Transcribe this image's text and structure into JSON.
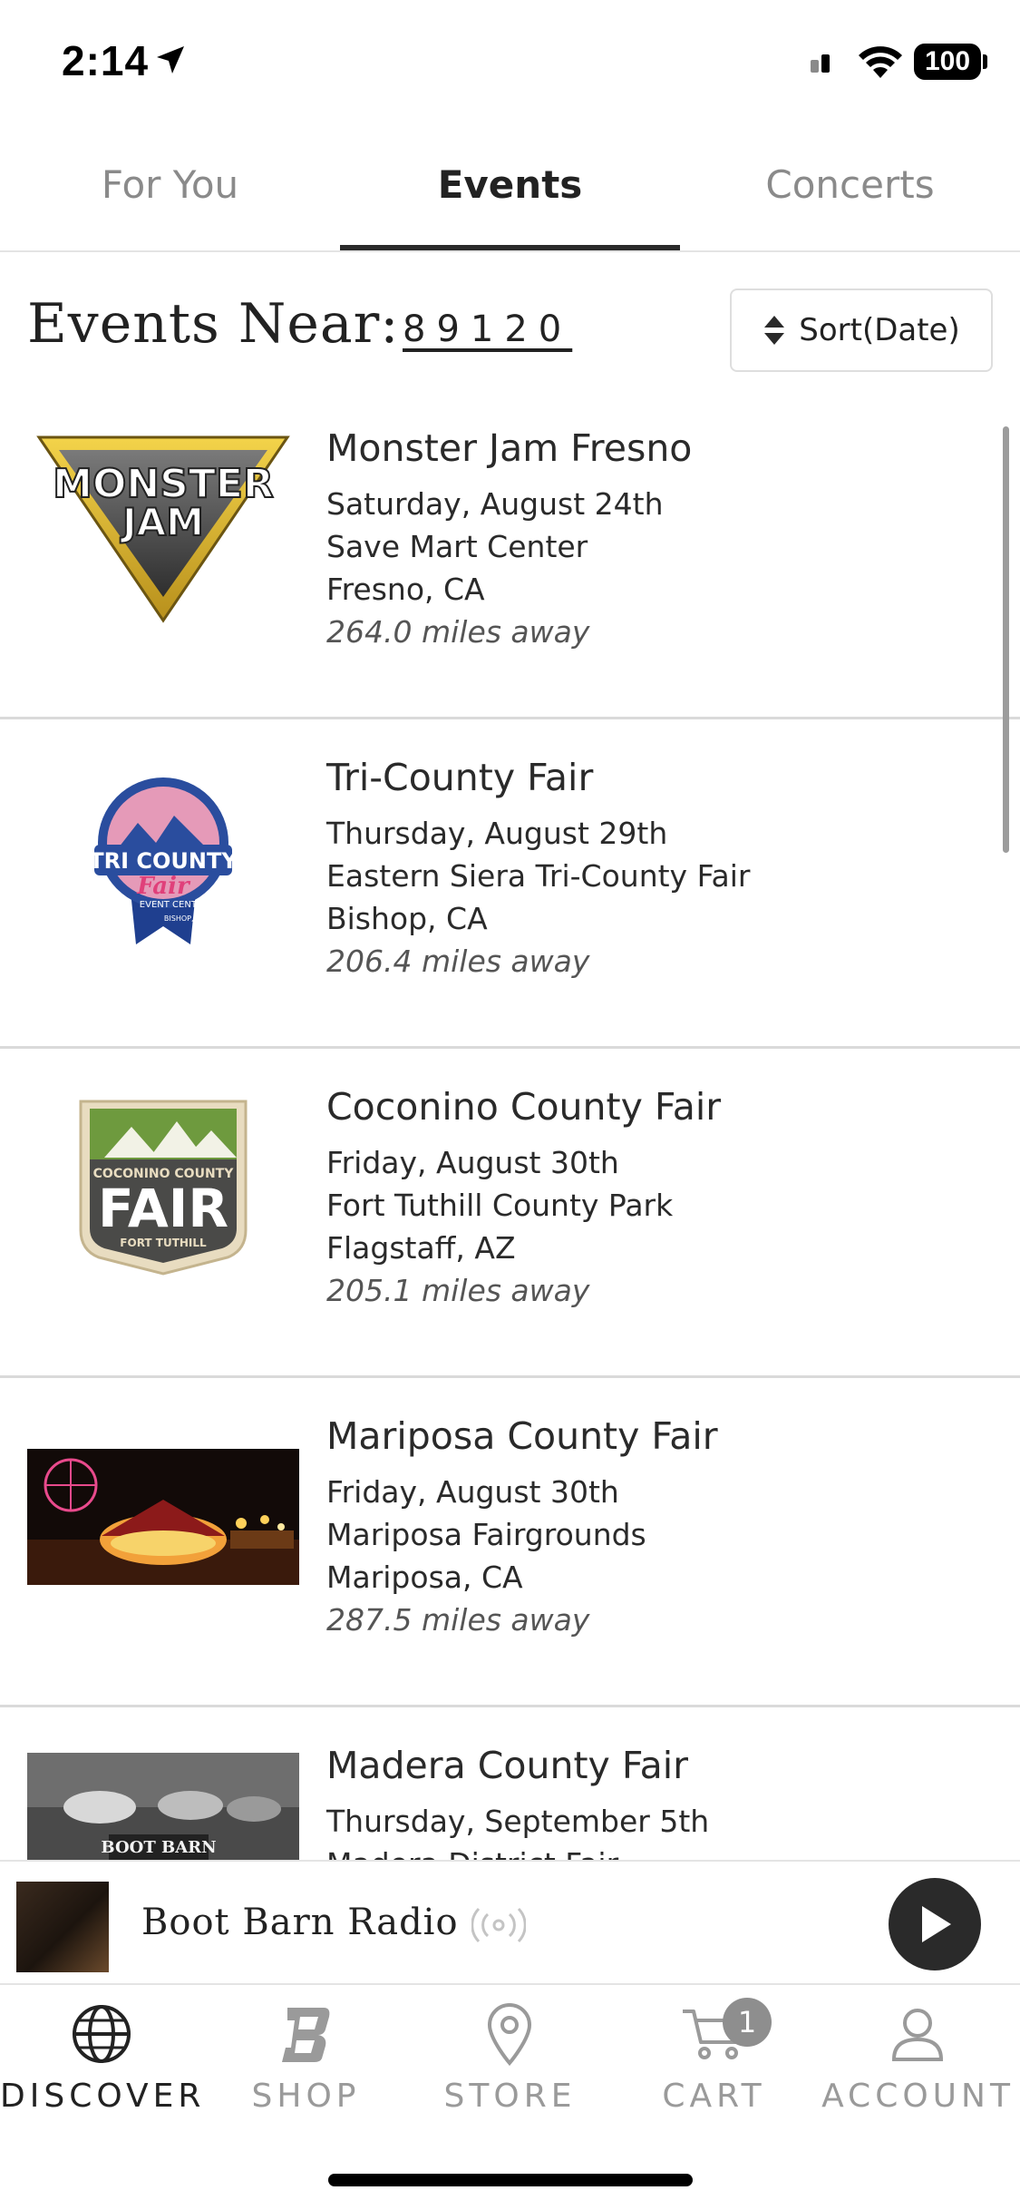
{
  "status_bar": {
    "time": "2:14",
    "battery": "100"
  },
  "tabs": [
    {
      "label": "For You"
    },
    {
      "label": "Events"
    },
    {
      "label": "Concerts"
    }
  ],
  "header": {
    "events_near_label": "Events Near:",
    "zip": "89120",
    "sort_label": "Sort(Date)"
  },
  "events": [
    {
      "title": "Monster Jam Fresno",
      "date": "Saturday, August 24th",
      "venue": "Save Mart Center",
      "city": "Fresno, CA",
      "distance": "264.0 miles away",
      "logo_text": [
        "MONSTER",
        "JAM"
      ]
    },
    {
      "title": "Tri-County Fair",
      "date": "Thursday, August 29th",
      "venue": "Eastern Siera Tri-County Fair",
      "city": "Bishop, CA",
      "distance": "206.4 miles away",
      "logo_text": [
        "TRI COUNTY",
        "Fair",
        "EVENT CENTER",
        "BISHOP, CA"
      ]
    },
    {
      "title": "Coconino County Fair",
      "date": "Friday, August 30th",
      "venue": "Fort Tuthill County Park",
      "city": "Flagstaff, AZ",
      "distance": "205.1 miles away",
      "logo_text": [
        "COCONINO COUNTY",
        "FAIR",
        "FORT TUTHILL"
      ]
    },
    {
      "title": "Mariposa County Fair",
      "date": "Friday, August 30th",
      "venue": "Mariposa Fairgrounds",
      "city": "Mariposa, CA",
      "distance": "287.5 miles away"
    },
    {
      "title": "Madera County Fair",
      "date": "Thursday, September 5th",
      "venue": "Madera District Fair",
      "city": "",
      "distance": "",
      "logo_text": [
        "BOOT BARN"
      ]
    }
  ],
  "player": {
    "title": "Boot Barn Radio"
  },
  "nav": [
    {
      "label": "DISCOVER",
      "icon": "globe-icon"
    },
    {
      "label": "SHOP",
      "icon": "boot-barn-logo-icon"
    },
    {
      "label": "STORE",
      "icon": "location-pin-icon"
    },
    {
      "label": "CART",
      "icon": "cart-icon",
      "badge": "1"
    },
    {
      "label": "ACCOUNT",
      "icon": "person-icon"
    }
  ]
}
